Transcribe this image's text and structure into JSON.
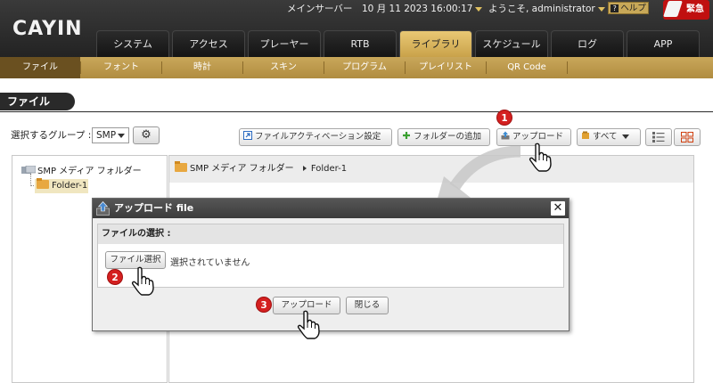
{
  "header": {
    "logo": "CAYIN",
    "server": "メインサーバー",
    "datetime": "10 月 11 2023 16:00:17",
    "welcome": "ようこそ, administrator",
    "help": "ヘルプ",
    "emergency": "緊急"
  },
  "tabs": [
    "システム",
    "アクセス",
    "プレーヤー",
    "RTB",
    "ライブラリ",
    "スケジュール",
    "ログ",
    "APP"
  ],
  "active_tab": "ライブラリ",
  "subnav": [
    "ファイル",
    "フォント",
    "時計",
    "スキン",
    "プログラム",
    "プレイリスト",
    "QR Code"
  ],
  "active_subnav": "ファイル",
  "page_title": "ファイル",
  "toolbar": {
    "group_label": "選択するグループ :",
    "group_value": "SMP",
    "file_activation": "ファイルアクティベーション設定",
    "add_folder": "フォルダーの追加",
    "upload": "アップロード",
    "filter": "すべて"
  },
  "tree": {
    "root": "SMP メディア フォルダー",
    "folder": "Folder-1"
  },
  "breadcrumb": {
    "root": "SMP メディア フォルダー",
    "current": "Folder-1"
  },
  "modal": {
    "title": "アップロード file",
    "section": "ファイルの選択 :",
    "choose_file": "ファイル選択",
    "no_file": "選択されていません",
    "upload": "アップロード",
    "close": "閉じる"
  },
  "steps": [
    "1",
    "2",
    "3"
  ],
  "colors": {
    "accent": "#c9a75a",
    "badge": "#d42020",
    "header": "#2b2b2b"
  }
}
